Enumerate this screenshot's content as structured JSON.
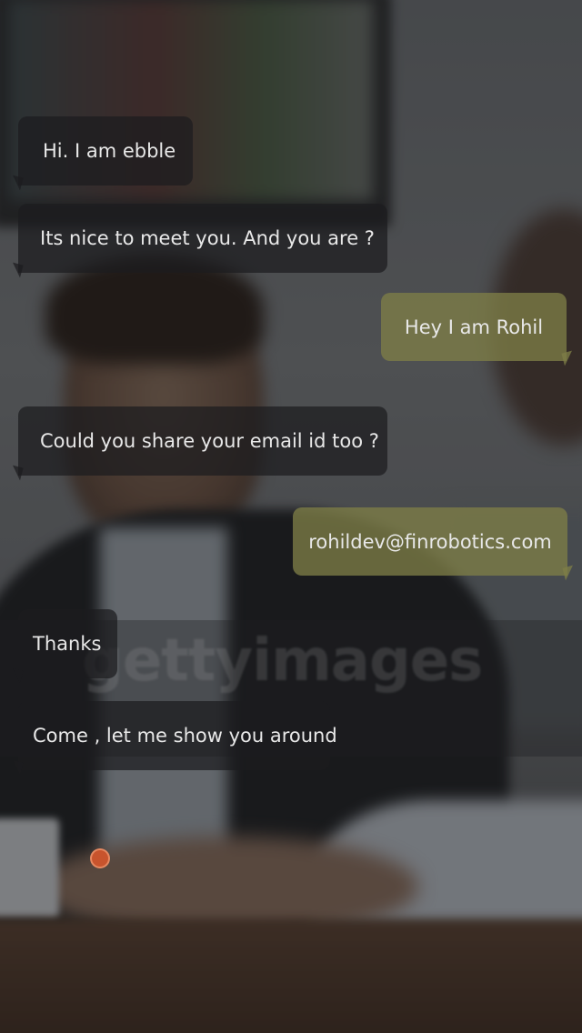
{
  "watermark": {
    "text": "gettyimages"
  },
  "messages": [
    {
      "sender": "bot",
      "text": "Hi. I am ebble"
    },
    {
      "sender": "bot",
      "text": "Its nice to meet you. And you are ?"
    },
    {
      "sender": "user",
      "text": "Hey I am Rohil"
    },
    {
      "sender": "bot",
      "text": "Could you share your email id too ?"
    },
    {
      "sender": "user",
      "text": "rohildev@finrobotics.com"
    },
    {
      "sender": "bot",
      "text": "Thanks"
    },
    {
      "sender": "bot",
      "text": "Come , let me show you around"
    }
  ],
  "colors": {
    "bot_bubble": "#1c1c1e",
    "user_bubble": "#7d7d46",
    "mic_indicator": "#c8542d"
  },
  "icons": {
    "mic_indicator": "recording-dot-icon"
  }
}
